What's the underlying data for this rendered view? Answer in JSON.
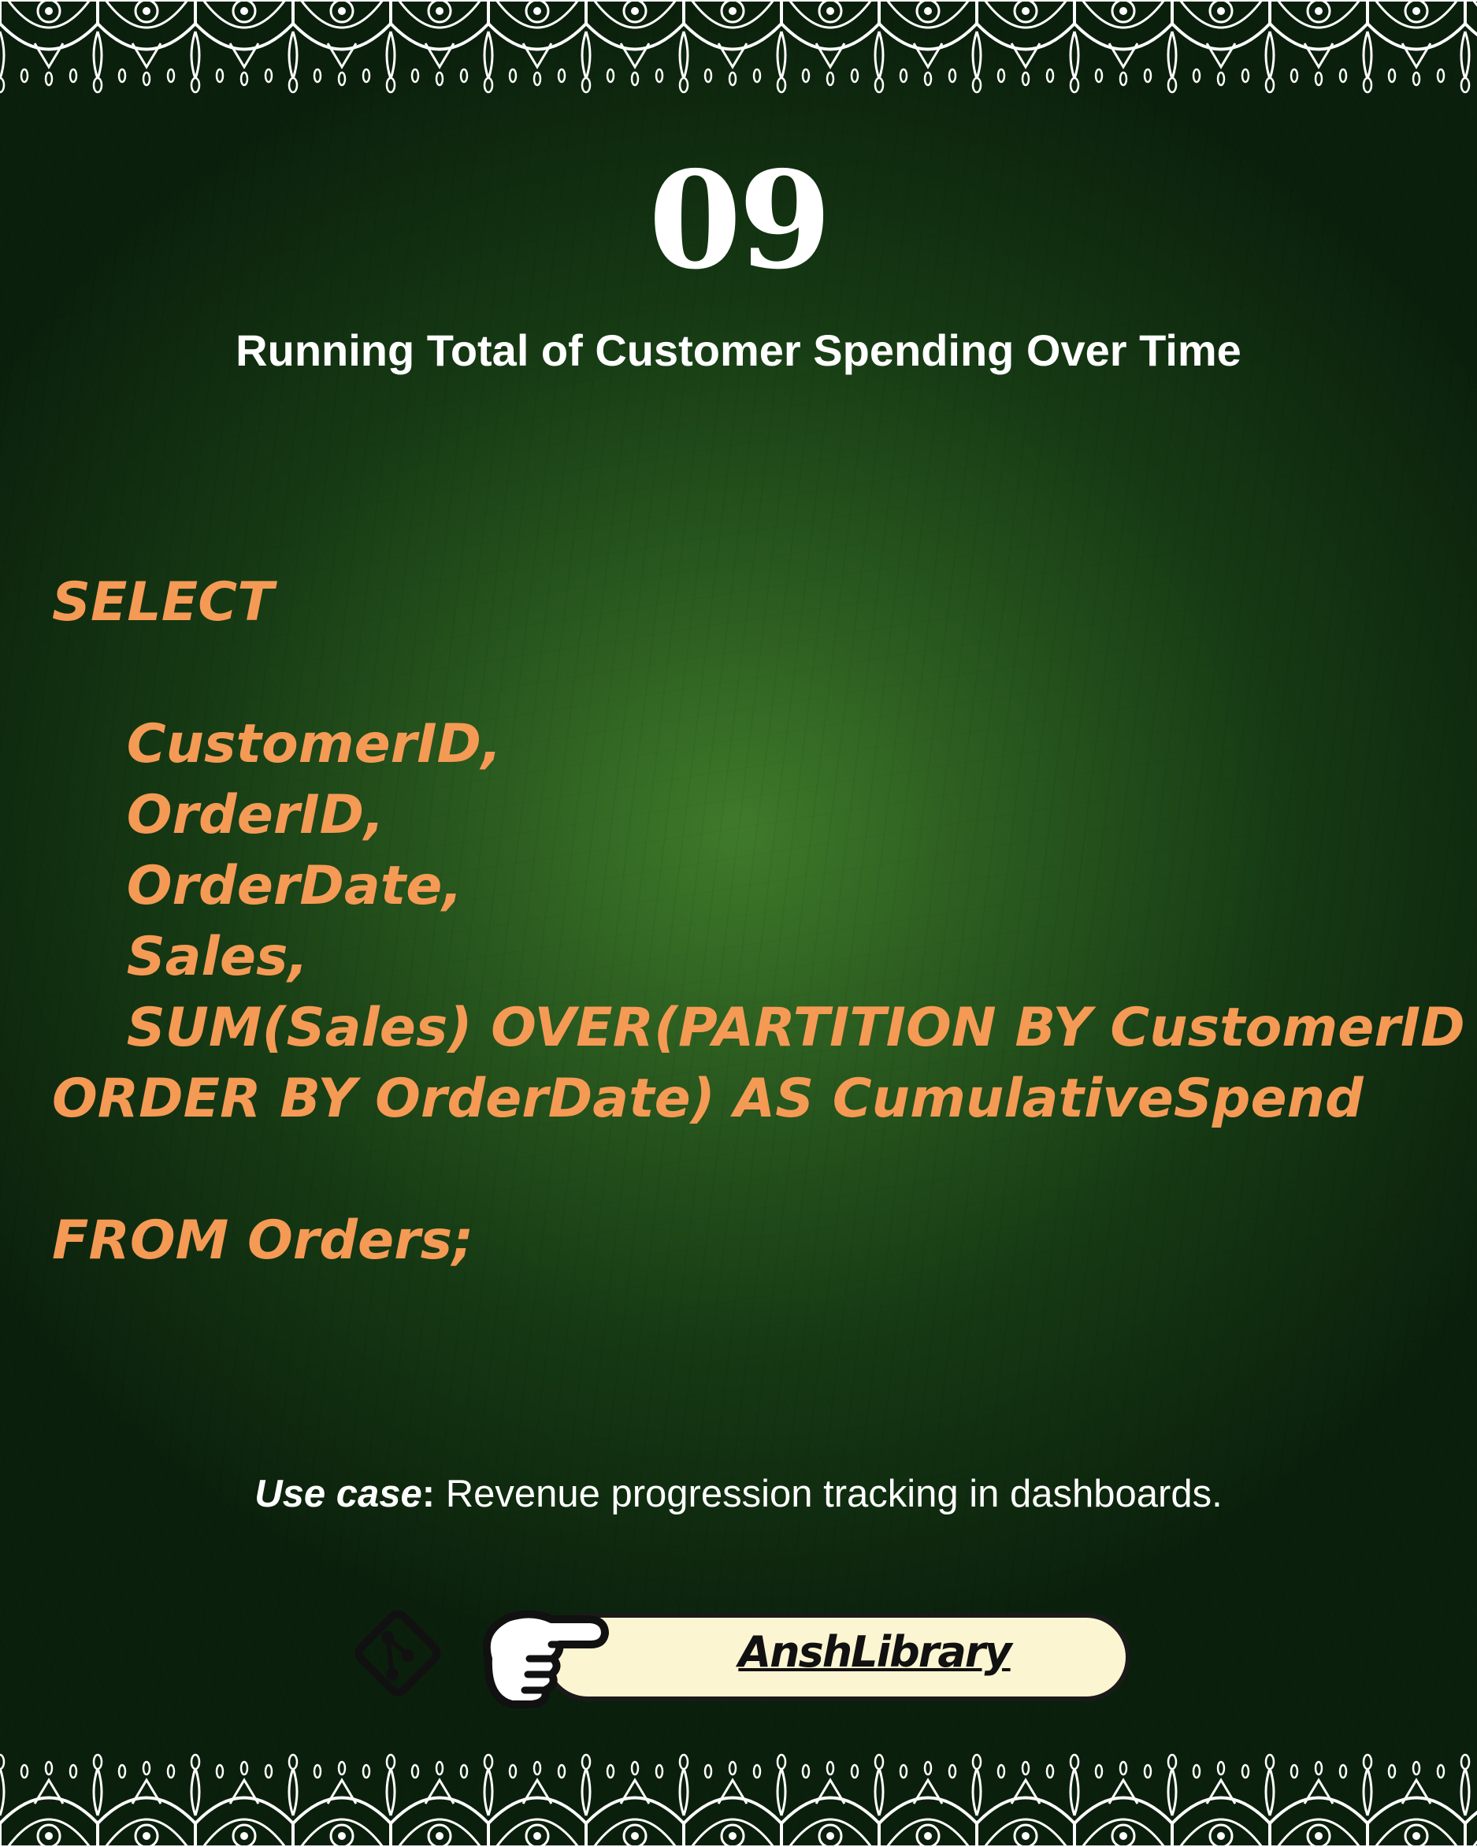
{
  "slide": {
    "number": "09",
    "title": "Running Total of Customer Spending Over Time"
  },
  "code": {
    "lines": [
      "SELECT",
      "",
      "    CustomerID,",
      "    OrderID,",
      "    OrderDate,",
      "    Sales,",
      "    SUM(Sales) OVER(PARTITION BY CustomerID",
      "ORDER BY OrderDate) AS CumulativeSpend",
      "",
      "FROM Orders;"
    ]
  },
  "use_case": {
    "label": "Use case",
    "colon": ":",
    "text": " Revenue progression tracking in dashboards."
  },
  "footer": {
    "brand": "AnshLibrary",
    "left_icon": "git-branch-icon",
    "hand_icon": "pointing-hand-icon"
  },
  "colors": {
    "code": "#f59a55",
    "background": "#1f4a18",
    "pill": "#fbf5d2"
  }
}
